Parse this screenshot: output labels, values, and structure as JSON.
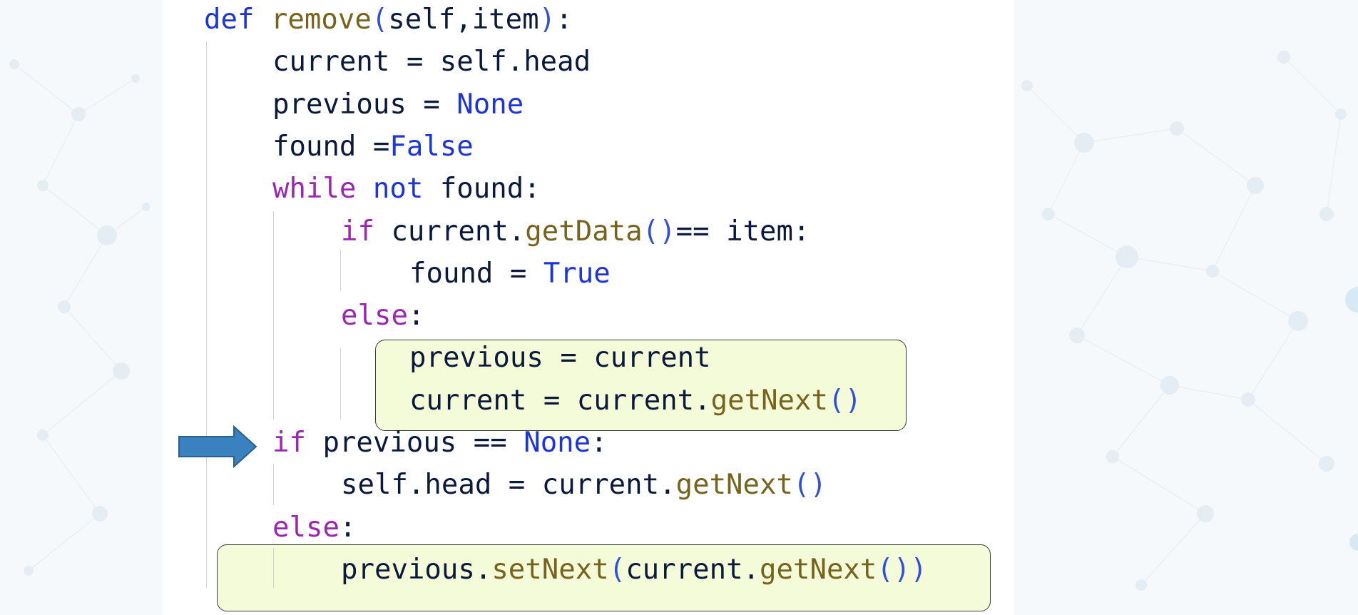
{
  "colors": {
    "page_background": "#f6f9fb",
    "panel_background": "#ffffff",
    "highlight_fill": "#f4fbd8",
    "highlight_border": "#3a3a3a",
    "arrow": "#3a82bf",
    "plain": "#0b1a3c",
    "keyword": "#9b27b0",
    "constant": "#1b35d6",
    "function": "#76631e",
    "paren": "#3050d8"
  },
  "icons": {
    "pointer": "right-arrow-icon"
  },
  "code": {
    "language": "python",
    "lines": [
      {
        "indent": 0,
        "tokens": [
          {
            "t": "def ",
            "c": "const"
          },
          {
            "t": "remove",
            "c": "func"
          },
          {
            "t": "(",
            "c": "paren"
          },
          {
            "t": "self,item",
            "c": "plain"
          },
          {
            "t": ")",
            "c": "paren"
          },
          {
            "t": ":",
            "c": "plain"
          }
        ]
      },
      {
        "indent": 1,
        "tokens": [
          {
            "t": "current = self.head",
            "c": "plain"
          }
        ]
      },
      {
        "indent": 1,
        "tokens": [
          {
            "t": "previous = ",
            "c": "plain"
          },
          {
            "t": "None",
            "c": "const"
          }
        ]
      },
      {
        "indent": 1,
        "tokens": [
          {
            "t": "found =",
            "c": "plain"
          },
          {
            "t": "False",
            "c": "const"
          }
        ]
      },
      {
        "indent": 1,
        "tokens": [
          {
            "t": "while",
            "c": "keyword"
          },
          {
            "t": " ",
            "c": "plain"
          },
          {
            "t": "not",
            "c": "const"
          },
          {
            "t": " found:",
            "c": "plain"
          }
        ]
      },
      {
        "indent": 2,
        "tokens": [
          {
            "t": "if",
            "c": "keyword"
          },
          {
            "t": " current.",
            "c": "plain"
          },
          {
            "t": "getData",
            "c": "func"
          },
          {
            "t": "()",
            "c": "paren"
          },
          {
            "t": "== item:",
            "c": "plain"
          }
        ]
      },
      {
        "indent": 3,
        "tokens": [
          {
            "t": "found = ",
            "c": "plain"
          },
          {
            "t": "True",
            "c": "const"
          }
        ]
      },
      {
        "indent": 2,
        "tokens": [
          {
            "t": "else",
            "c": "keyword"
          },
          {
            "t": ":",
            "c": "plain"
          }
        ]
      },
      {
        "indent": 3,
        "tokens": [
          {
            "t": "previous = current",
            "c": "plain"
          }
        ]
      },
      {
        "indent": 3,
        "tokens": [
          {
            "t": "current = current.",
            "c": "plain"
          },
          {
            "t": "getNext",
            "c": "func"
          },
          {
            "t": "()",
            "c": "paren"
          }
        ]
      },
      {
        "indent": 1,
        "tokens": [
          {
            "t": "if",
            "c": "keyword"
          },
          {
            "t": " previous == ",
            "c": "plain"
          },
          {
            "t": "None",
            "c": "const"
          },
          {
            "t": ":",
            "c": "plain"
          }
        ]
      },
      {
        "indent": 2,
        "tokens": [
          {
            "t": "self.head = current.",
            "c": "plain"
          },
          {
            "t": "getNext",
            "c": "func"
          },
          {
            "t": "()",
            "c": "paren"
          }
        ]
      },
      {
        "indent": 1,
        "tokens": [
          {
            "t": "else",
            "c": "keyword"
          },
          {
            "t": ":",
            "c": "plain"
          }
        ]
      },
      {
        "indent": 2,
        "tokens": [
          {
            "t": "previous.",
            "c": "plain"
          },
          {
            "t": "setNext",
            "c": "func"
          },
          {
            "t": "(",
            "c": "paren"
          },
          {
            "t": "current.",
            "c": "plain"
          },
          {
            "t": "getNext",
            "c": "func"
          },
          {
            "t": "())",
            "c": "paren"
          }
        ]
      }
    ],
    "highlighted_line_groups": [
      [
        8,
        9
      ],
      [
        13
      ]
    ],
    "pointer_line": 10
  }
}
